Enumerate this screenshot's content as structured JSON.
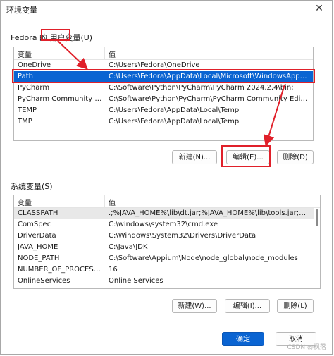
{
  "window": {
    "title": "环境变量",
    "close_glyph": "✕"
  },
  "user_section": {
    "label_prefix": "Fedora 的 ",
    "label_highlight": "用户变量",
    "label_suffix": "(U)",
    "col_var": "变量",
    "col_val": "值",
    "rows": [
      {
        "name": "OneDrive",
        "value": "C:\\Users\\Fedora\\OneDrive"
      },
      {
        "name": "Path",
        "value": "C:\\Users\\Fedora\\AppData\\Local\\Microsoft\\WindowsApps;C:\\..."
      },
      {
        "name": "PyCharm",
        "value": "C:\\Software\\Python\\PyCharm\\PyCharm 2024.2.4\\bin;"
      },
      {
        "name": "PyCharm Community Edition",
        "value": "C:\\Software\\Python\\PyCharm\\PyCharm Community Edition 20..."
      },
      {
        "name": "TEMP",
        "value": "C:\\Users\\Fedora\\AppData\\Local\\Temp"
      },
      {
        "name": "TMP",
        "value": "C:\\Users\\Fedora\\AppData\\Local\\Temp"
      }
    ],
    "buttons": {
      "new": "新建(N)...",
      "edit": "编辑(E)...",
      "delete": "删除(D)"
    }
  },
  "system_section": {
    "label": "系统变量(S)",
    "col_var": "变量",
    "col_val": "值",
    "rows": [
      {
        "name": "CLASSPATH",
        "value": ".;%JAVA_HOME%\\lib\\dt.jar;%JAVA_HOME%\\lib\\tools.jar;%JAV..."
      },
      {
        "name": "ComSpec",
        "value": "C:\\windows\\system32\\cmd.exe"
      },
      {
        "name": "DriverData",
        "value": "C:\\Windows\\System32\\Drivers\\DriverData"
      },
      {
        "name": "JAVA_HOME",
        "value": "C:\\Java\\JDK"
      },
      {
        "name": "NODE_PATH",
        "value": "C:\\Software\\Appium\\Node\\node_global\\node_modules"
      },
      {
        "name": "NUMBER_OF_PROCESSORS",
        "value": "16"
      },
      {
        "name": "OnlineServices",
        "value": "Online Services"
      }
    ],
    "buttons": {
      "new": "新建(W)...",
      "edit": "编辑(I)...",
      "delete": "删除(L)"
    }
  },
  "footer": {
    "ok": "确定",
    "cancel": "取消"
  },
  "watermark": "CSDN @枫落",
  "colors": {
    "selection": "#0a64d2",
    "annotation": "#e0202a"
  }
}
